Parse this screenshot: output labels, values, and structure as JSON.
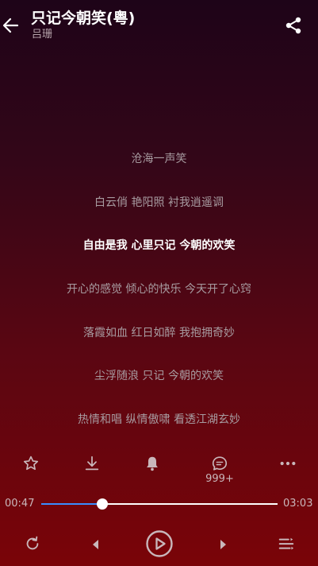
{
  "header": {
    "title": "只记今朝笑(粤)",
    "artist": "吕珊",
    "back_icon": "arrow-left-icon",
    "share_icon": "share-icon"
  },
  "lyrics": [
    "沧海一声笑",
    "白云俏 艳阳照 衬我逍遥调",
    "自由是我 心里只记 今朝的欢笑",
    "开心的感觉 倾心的快乐 今天开了心窍",
    "落霞如血 红日如醉 我抱拥奇妙",
    "尘浮随浪 只记 今朝的欢笑",
    "热情和唱 纵情傲啸 看透江湖玄妙"
  ],
  "current_lyric_index": 2,
  "actions": {
    "favorite_icon": "star-outline-icon",
    "download_icon": "download-icon",
    "ringtone_icon": "bell-icon",
    "comment_icon": "comment-icon",
    "comment_count": "999+",
    "more_icon": "more-horizontal-icon"
  },
  "progress": {
    "elapsed": "00:47",
    "total": "03:03",
    "fraction": 0.2568
  },
  "controls": {
    "repeat_icon": "repeat-icon",
    "previous_icon": "previous-icon",
    "play_icon": "play-circle-icon",
    "next_icon": "next-icon",
    "playlist_icon": "playlist-icon"
  },
  "colors": {
    "background_top": "#1e0418",
    "background_bottom": "#7a0408",
    "progress_played": "#3a8dff",
    "lyric_current": "#ffffff",
    "lyric_other": "#a79ba0",
    "icon_muted": "#c9b7bb"
  }
}
